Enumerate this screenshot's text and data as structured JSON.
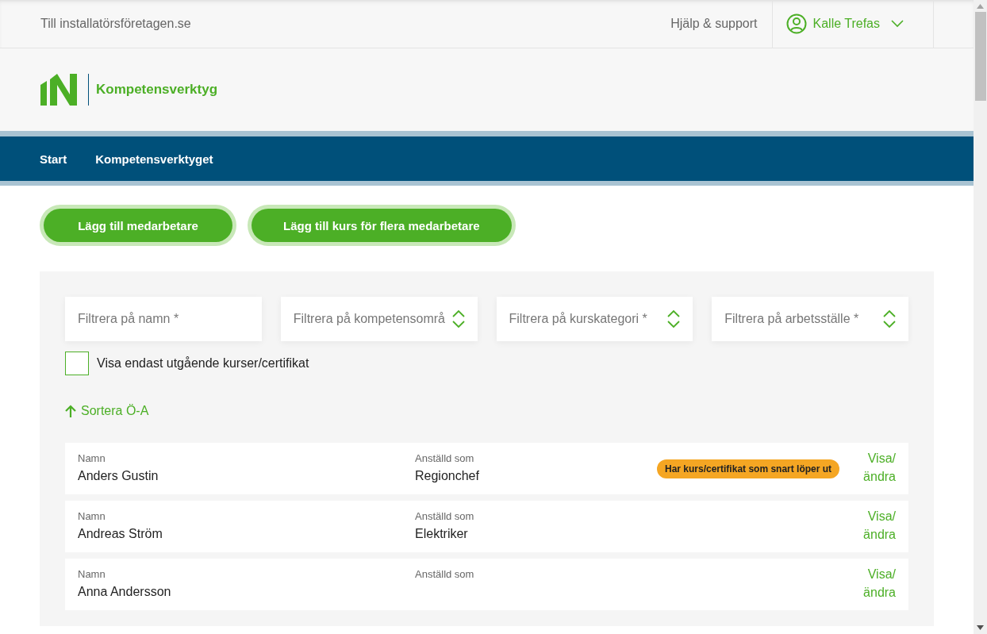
{
  "topbar": {
    "site_link": "Till installatörsföretagen.se",
    "help_link": "Hjälp & support",
    "user": {
      "name": "Kalle Trefas"
    }
  },
  "header": {
    "title": "Kompetensverktyg"
  },
  "nav": [
    {
      "label": "Start"
    },
    {
      "label": "Kompetensverktyget"
    }
  ],
  "actions": [
    "Lägg till medarbetare",
    "Lägg till kurs för flera medarbetare"
  ],
  "filters": [
    {
      "kind": "text",
      "placeholder": "Filtrera på namn *"
    },
    {
      "kind": "select",
      "placeholder": "Filtrera på kompetensområ"
    },
    {
      "kind": "select",
      "placeholder": "Filtrera på kurskategori *"
    },
    {
      "kind": "select",
      "placeholder": "Filtrera på arbetsställe *"
    }
  ],
  "only_expiring": {
    "label": "Visa endast utgående kurser/certifikat",
    "checked": false
  },
  "sort": {
    "label": "Sortera Ö-A"
  },
  "employees": [
    {
      "name_label": "Namn",
      "name": "Anders Gustin",
      "role_label": "Anställd som",
      "role": "Regionchef",
      "badge": "Har kurs/certifikat som snart löper ut",
      "link": [
        "Visa/",
        "ändra"
      ]
    },
    {
      "name_label": "Namn",
      "name": "Andreas Ström",
      "role_label": "Anställd som",
      "role": "Elektriker",
      "link": [
        "Visa/",
        "ändra"
      ]
    },
    {
      "name_label": "Namn",
      "name": "Anna Andersson",
      "role_label": "Anställd som",
      "link": [
        "Visa/",
        "ändra"
      ]
    }
  ]
}
